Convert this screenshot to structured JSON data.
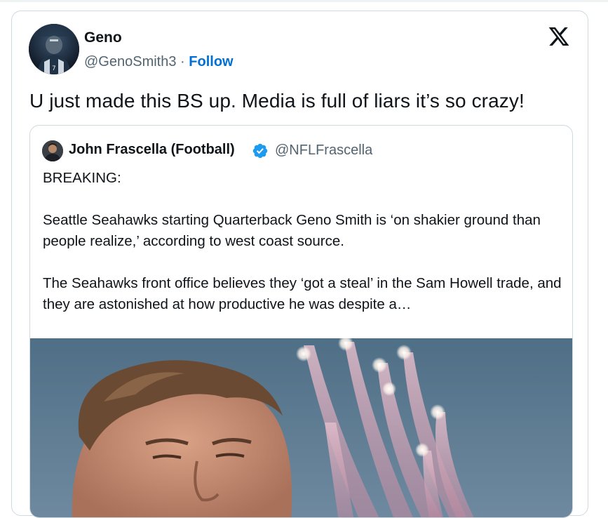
{
  "author": {
    "name": "Geno",
    "handle": "@GenoSmith3",
    "separator": "·",
    "follow_label": "Follow"
  },
  "platform_icon": "x-logo-icon",
  "tweet": {
    "text": "U just made this BS up. Media is full of liars it’s so crazy!"
  },
  "quoted_tweet": {
    "author_name": "John Frascella (Football)",
    "verified_icon": "verified-badge-icon",
    "handle": "@NFLFrascella",
    "paragraphs": [
      "BREAKING:",
      "Seattle Seahawks starting Quarterback Geno Smith is ‘on shakier ground than people realize,’ according to west coast source.",
      "The Seahawks front office believes they ‘got a steal’ in the Sam Howell trade, and they are astonished at how productive he was despite a…"
    ]
  },
  "colors": {
    "text": "#0f1419",
    "muted": "#536471",
    "link": "#006fd6",
    "verified": "#1d9bf0",
    "border": "#cfd9de"
  }
}
